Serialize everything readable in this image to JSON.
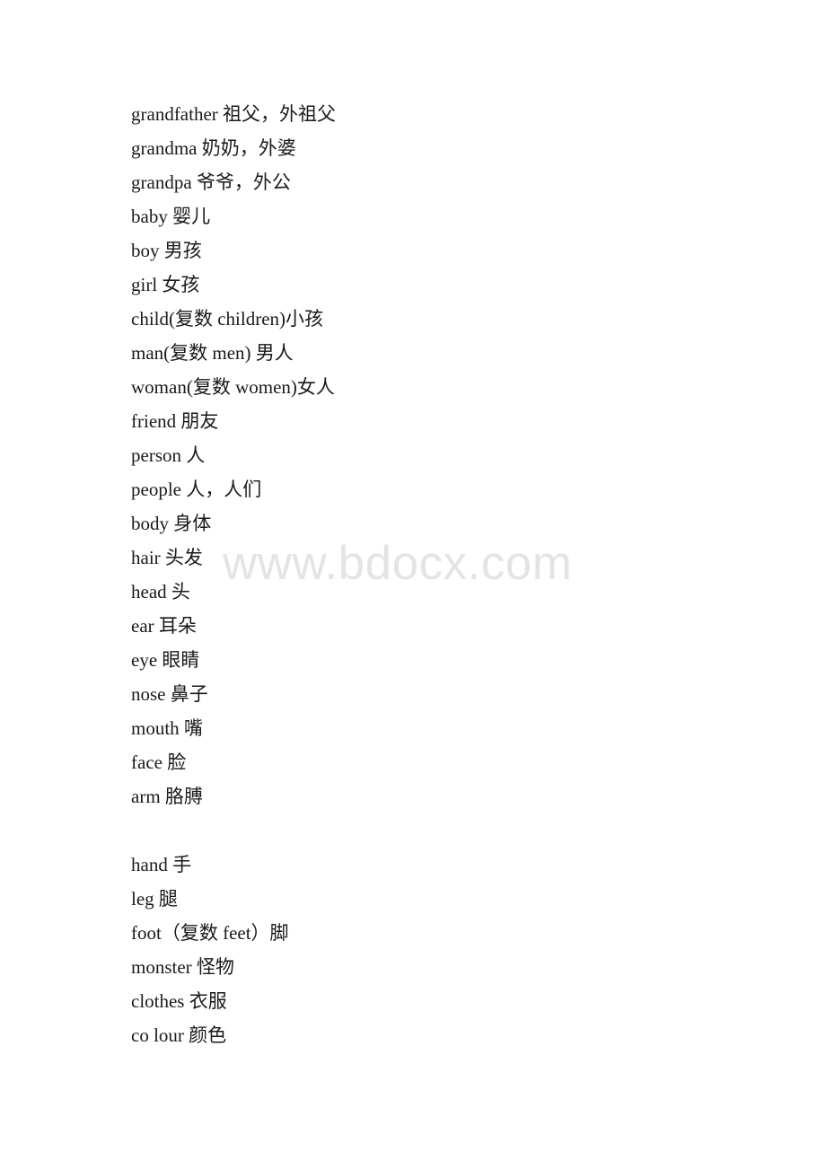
{
  "document": {
    "watermark": "www.bdocx.com",
    "watermark_color": "#e4e4e4",
    "text_color": "#1a1a1a",
    "background_color": "#ffffff",
    "lines": [
      {
        "id": "grandfather",
        "text": "grandfather 祖父，外祖父"
      },
      {
        "id": "grandma",
        "text": "grandma 奶奶，外婆"
      },
      {
        "id": "grandpa",
        "text": "grandpa 爷爷，外公"
      },
      {
        "id": "baby",
        "text": "baby 婴儿"
      },
      {
        "id": "boy",
        "text": "boy 男孩"
      },
      {
        "id": "girl",
        "text": "girl 女孩"
      },
      {
        "id": "child",
        "text": "child(复数 children)小孩"
      },
      {
        "id": "man",
        "text": "man(复数 men) 男人"
      },
      {
        "id": "woman",
        "text": "woman(复数 women)女人"
      },
      {
        "id": "friend",
        "text": "friend 朋友"
      },
      {
        "id": "person",
        "text": "person 人"
      },
      {
        "id": "people",
        "text": "people 人，人们"
      },
      {
        "id": "body",
        "text": "body 身体"
      },
      {
        "id": "hair",
        "text": "hair 头发"
      },
      {
        "id": "head",
        "text": "head 头"
      },
      {
        "id": "ear",
        "text": "ear 耳朵"
      },
      {
        "id": "eye",
        "text": "eye 眼睛"
      },
      {
        "id": "nose",
        "text": "nose 鼻子"
      },
      {
        "id": "mouth",
        "text": "mouth 嘴"
      },
      {
        "id": "face",
        "text": "face 脸"
      },
      {
        "id": "arm",
        "text": "arm 胳膊"
      },
      {
        "id": "blank",
        "text": ""
      },
      {
        "id": "hand",
        "text": "hand 手"
      },
      {
        "id": "leg",
        "text": "leg 腿"
      },
      {
        "id": "foot",
        "text": "foot（复数 feet）脚"
      },
      {
        "id": "monster",
        "text": "monster 怪物"
      },
      {
        "id": "clothes",
        "text": "clothes 衣服"
      },
      {
        "id": "colour",
        "text": "co lour 颜色"
      }
    ]
  }
}
